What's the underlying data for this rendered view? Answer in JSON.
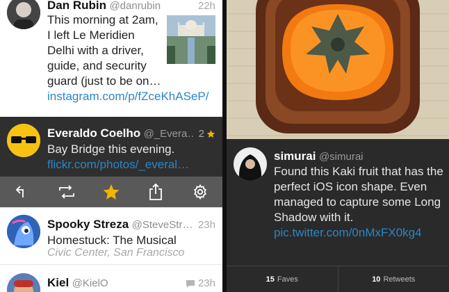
{
  "colors": {
    "link": "#2a86c8",
    "favorite_star": "#f4b400",
    "selected_background": "#2f2f2f",
    "action_bar_background": "#595959"
  },
  "timeline": {
    "tweets": [
      {
        "name": "Dan Rubin",
        "handle": "@danrubin",
        "time": "22h",
        "text": "This morning at 2am, I left Le Meridien Delhi with a driver, guide, and security guard (just to be on…",
        "link": "instagram.com/p/fZceKhASeP/"
      },
      {
        "name": "Everaldo Coelho",
        "handle": "@_Evera…",
        "time": "2",
        "text": "Bay Bridge this evening.",
        "link": "flickr.com/photos/_everal…"
      },
      {
        "name": "Spooky Streza",
        "handle": "@SteveStr…",
        "time": "23h",
        "text": "Homestuck: The Musical",
        "place": "Civic Center, San Francisco"
      },
      {
        "name": "Kiel",
        "handle": "@KielO",
        "time": "23h"
      }
    ],
    "actions": [
      "reply-icon",
      "retweet-icon",
      "favorite-star-icon",
      "share-icon",
      "gear-icon"
    ]
  },
  "detail": {
    "name": "simurai",
    "handle": "@simurai",
    "text": "Found this Kaki fruit that has the perfect iOS icon shape. Even managed to capture some Long Shadow with it.",
    "link": "pic.twitter.com/0nMxFX0kg4",
    "faves_count": "15",
    "faves_label": "Faves",
    "retweets_count": "10",
    "retweets_label": "Retweets"
  }
}
